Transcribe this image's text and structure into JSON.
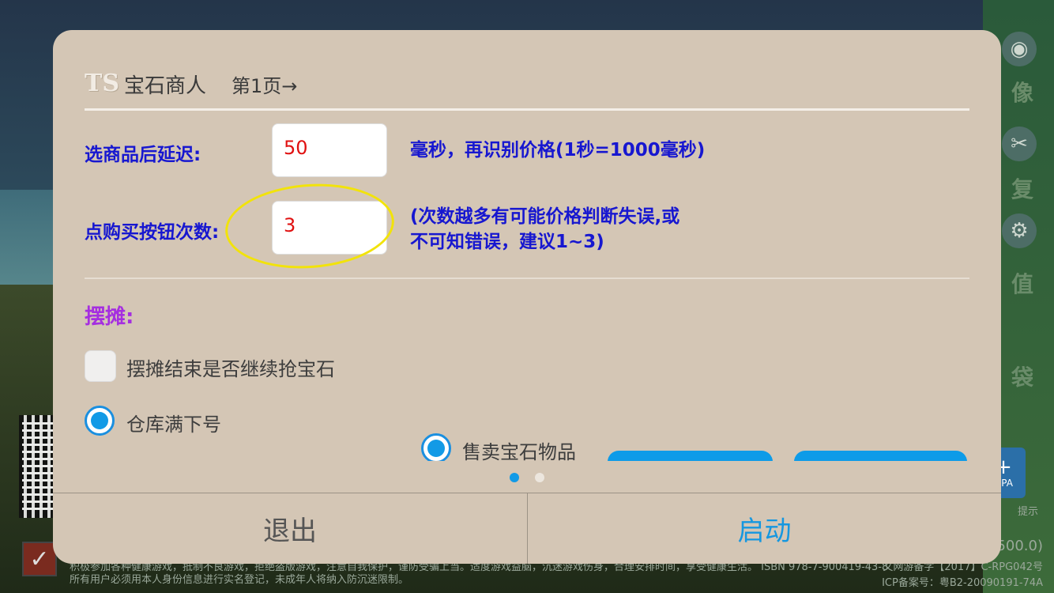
{
  "background": {
    "side_labels": [
      "像",
      "复",
      "值",
      "袋"
    ],
    "dpa_label": "DPA",
    "dpa_caption": "提示",
    "footer_line1": "积极参加各种健康游戏，抵制不良游戏，拒绝盗版游戏，注意自我保护，谨防受骗上当。适度游戏益脑，沉迷游戏伤身，合理安排时间，享受健康生活。 ISBN 978-7-900419-43-8",
    "footer_line2": "所有用户必须用本人身份信息进行实名登记，未成年人将纳入防沉迷限制。",
    "footer_right1": "文网游备字【2017】C-RPG042号",
    "footer_right2": "ICP备案号：粤B2-20090191-74A",
    "footer_right_top": "500.0)"
  },
  "dialog": {
    "logo": "TS",
    "title": "宝石商人",
    "page_label": "第1页→",
    "delay_label": "选商品后延迟:",
    "delay_value": "50",
    "delay_hint": "毫秒，再识别价格(1秒=1000毫秒)",
    "clicks_label": "点购买按钮次数:",
    "clicks_value": "3",
    "clicks_hint_line1": "(次数越多有可能价格判断失误,或",
    "clicks_hint_line2": "不可知错误，建议1~3)",
    "section_title": "摆摊:",
    "continue_option": "摆摊结束是否继续抢宝石",
    "warehouse_option": "仓库满下号",
    "sell_option": "售卖宝石物品",
    "exit_label": "退出",
    "start_label": "启动"
  },
  "colors": {
    "dialog_bg": "#d4c6b5",
    "label_blue": "#1717d0",
    "section_purple": "#a52ee0",
    "accent_blue": "#1597e0",
    "value_red": "#e01010",
    "highlight_yellow": "#f2e30a"
  }
}
